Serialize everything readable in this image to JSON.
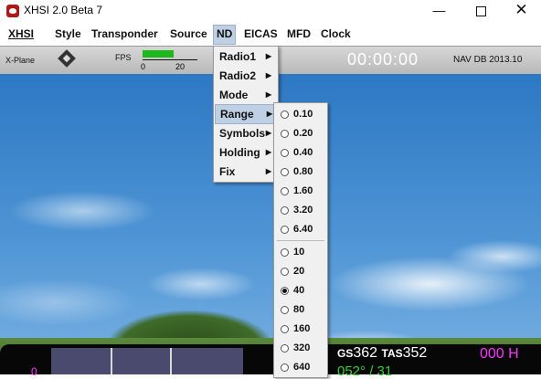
{
  "window": {
    "title": "XHSI 2.0 Beta 7"
  },
  "menubar": [
    {
      "label": "XHSI",
      "active": false
    },
    {
      "label": "Style",
      "active": false
    },
    {
      "label": "Transponder",
      "active": false
    },
    {
      "label": "Source",
      "active": false
    },
    {
      "label": "ND",
      "active": true
    },
    {
      "label": "EICAS",
      "active": false
    },
    {
      "label": "MFD",
      "active": false
    },
    {
      "label": "Clock",
      "active": false
    }
  ],
  "strip": {
    "source": "X-Plane",
    "fps_label": "FPS",
    "fps_fill": 0.57,
    "fps_scale": [
      "0",
      "20"
    ],
    "clock": "00:00:00",
    "navdb": "NAV DB 2013.10"
  },
  "nd_menu": {
    "items": [
      {
        "label": "Radio1"
      },
      {
        "label": "Radio2"
      },
      {
        "label": "Mode"
      },
      {
        "label": "Range"
      },
      {
        "label": "Symbols"
      },
      {
        "label": "Holding"
      },
      {
        "label": "Fix"
      }
    ],
    "active": "Range"
  },
  "range_menu": {
    "group1": [
      "0.10",
      "0.20",
      "0.40",
      "0.80",
      "1.60",
      "3.20",
      "6.40"
    ],
    "group2": [
      "10",
      "20",
      "40",
      "80",
      "160",
      "320",
      "640"
    ],
    "selected": "40"
  },
  "panel": {
    "left_value": "0",
    "gs_label": "GS",
    "gs_value": "362",
    "tas_label": "TAS",
    "tas_value": "352",
    "heading": "000 H",
    "wind": "052° / 31"
  },
  "colors": {
    "accent_magenta": "#ff33ff",
    "wind_green": "#33d033",
    "menu_highlight": "#c0d0e4"
  }
}
